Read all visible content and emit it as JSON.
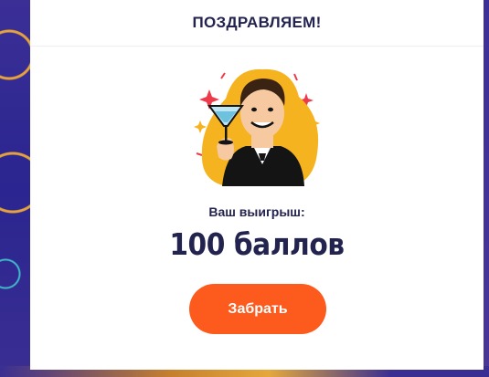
{
  "modal": {
    "title": "ПОЗДРАВЛЯЕМ!",
    "win_label": "Ваш выигрыш:",
    "win_amount": "100 баллов",
    "claim_label": "Забрать"
  },
  "colors": {
    "accent": "#fd5a1e",
    "text": "#23234f",
    "background": "#2b2a86",
    "sticker_outline": "#f5b31f"
  },
  "icons": [
    "celebration-sticker-icon"
  ]
}
